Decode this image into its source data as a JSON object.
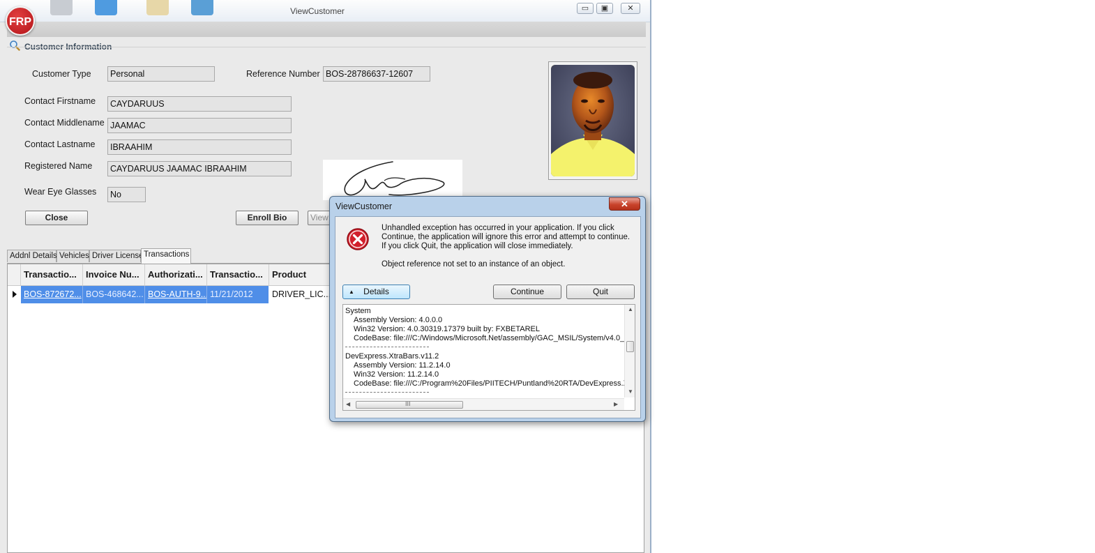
{
  "window": {
    "title": "ViewCustomer",
    "logo_text": "FRP",
    "minimize_glyph": "▭",
    "maximize_glyph": "▣",
    "close_glyph": "✕"
  },
  "section": {
    "title": "Customer Information",
    "icon": "search-icon"
  },
  "form": {
    "customer_type_label": "Customer Type",
    "customer_type_value": "Personal",
    "reference_label": "Reference Number",
    "reference_value": "BOS-28786637-12607",
    "firstname_label": "Contact Firstname",
    "firstname_value": "CAYDARUUS",
    "middlename_label": "Contact Middlename",
    "middlename_value": "JAAMAC",
    "lastname_label": "Contact Lastname",
    "lastname_value": "IBRAAHIM",
    "registered_label": "Registered Name",
    "registered_value": "CAYDARUUS JAAMAC IBRAAHIM",
    "glasses_label": "Wear Eye Glasses",
    "glasses_value": "No"
  },
  "buttons": {
    "close": "Close",
    "enroll_bio": "Enroll Bio",
    "view": "View"
  },
  "tabs": [
    "Addnl Details",
    "Vehicles",
    "Driver License",
    "Transactions"
  ],
  "grid": {
    "columns": [
      "Transactio...",
      "Invoice Nu...",
      "Authorizati...",
      "Transactio...",
      "Product"
    ],
    "row": [
      "BOS-872672...",
      "BOS-468642...",
      "BOS-AUTH-9...",
      "11/21/2012",
      "DRIVER_LIC..."
    ]
  },
  "dialog": {
    "title": "ViewCustomer",
    "close_glyph": "✕",
    "message": "Unhandled exception has occurred in your application. If you click Continue, the application will ignore this error and attempt to continue. If you click Quit, the application will close immediately.",
    "detail_message": "Object reference not set to an instance of an object.",
    "details_button": "Details",
    "details_arrow": "▲",
    "continue_button": "Continue",
    "quit_button": "Quit",
    "details_lines": {
      "l1": "System",
      "l2": "Assembly Version: 4.0.0.0",
      "l3": "Win32 Version: 4.0.30319.17379 built by: FXBETAREL",
      "l4": "CodeBase: file:///C:/Windows/Microsoft.Net/assembly/GAC_MSIL/System/v4.0_",
      "l5": "DevExpress.XtraBars.v11.2",
      "l6": "Assembly Version: 11.2.14.0",
      "l7": "Win32 Version: 11.2.14.0",
      "l8": "CodeBase: file:///C:/Program%20Files/PIITECH/Puntland%20RTA/DevExpress.X"
    },
    "hscroll_grip": "III"
  },
  "colors": {
    "selection": "#4f8ee8",
    "error_red": "#c8102e",
    "dialog_frame": "#b9d1ea"
  }
}
